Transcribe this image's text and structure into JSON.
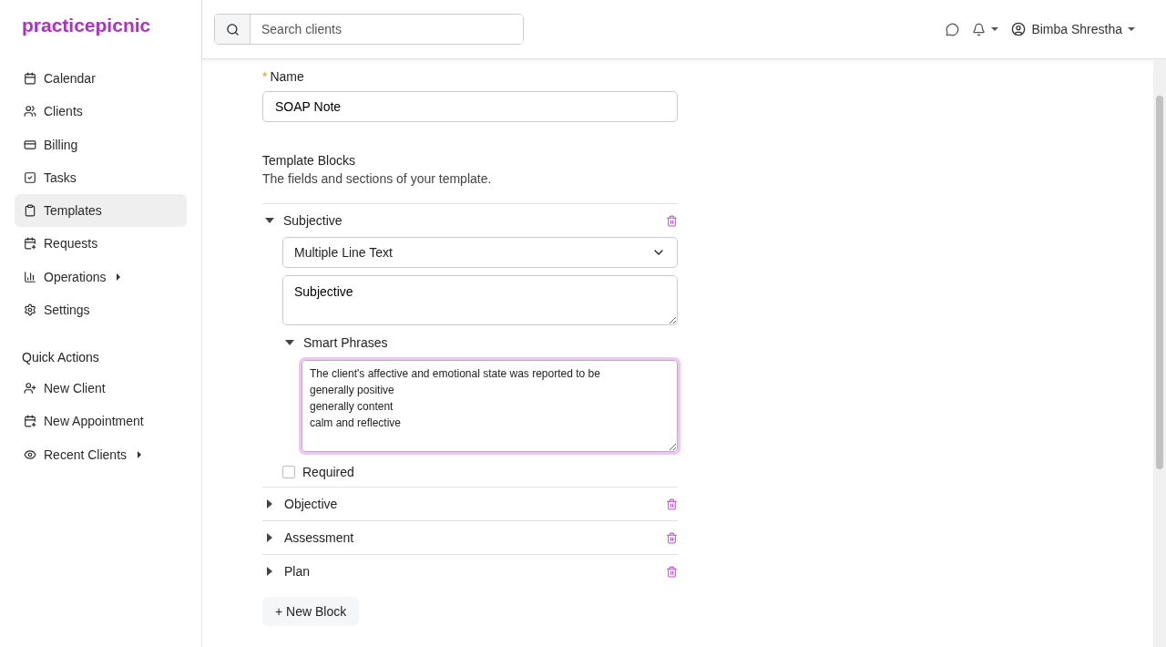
{
  "brand": "practicepicnic",
  "search": {
    "placeholder": "Search clients"
  },
  "user": {
    "name": "Bimba Shrestha"
  },
  "nav": [
    {
      "label": "Calendar",
      "selected": false,
      "submenu": false
    },
    {
      "label": "Clients",
      "selected": false,
      "submenu": false
    },
    {
      "label": "Billing",
      "selected": false,
      "submenu": false
    },
    {
      "label": "Tasks",
      "selected": false,
      "submenu": false
    },
    {
      "label": "Templates",
      "selected": true,
      "submenu": false
    },
    {
      "label": "Requests",
      "selected": false,
      "submenu": false
    },
    {
      "label": "Operations",
      "selected": false,
      "submenu": true
    },
    {
      "label": "Settings",
      "selected": false,
      "submenu": false
    }
  ],
  "quick_actions": {
    "title": "Quick Actions",
    "items": [
      {
        "label": "New Client",
        "submenu": false
      },
      {
        "label": "New Appointment",
        "submenu": false
      },
      {
        "label": "Recent Clients",
        "submenu": true
      }
    ]
  },
  "form": {
    "name_label": "Name",
    "required_mark": "*",
    "name_value": "SOAP Note",
    "blocks_title": "Template Blocks",
    "blocks_subtitle": "The fields and sections of your template.",
    "blocks": [
      {
        "title": "Subjective",
        "expanded": true,
        "type": "Multiple Line Text",
        "label_value": "Subjective",
        "smart_phrases": {
          "title": "Smart Phrases",
          "expanded": true,
          "lines": [
            "The client's affective and emotional state was reported to be",
            "generally positive",
            "generally content",
            "calm and reflective"
          ]
        },
        "required_label": "Required",
        "required": false
      },
      {
        "title": "Objective",
        "expanded": false
      },
      {
        "title": "Assessment",
        "expanded": false
      },
      {
        "title": "Plan",
        "expanded": false
      }
    ],
    "new_block": "+ New Block"
  }
}
